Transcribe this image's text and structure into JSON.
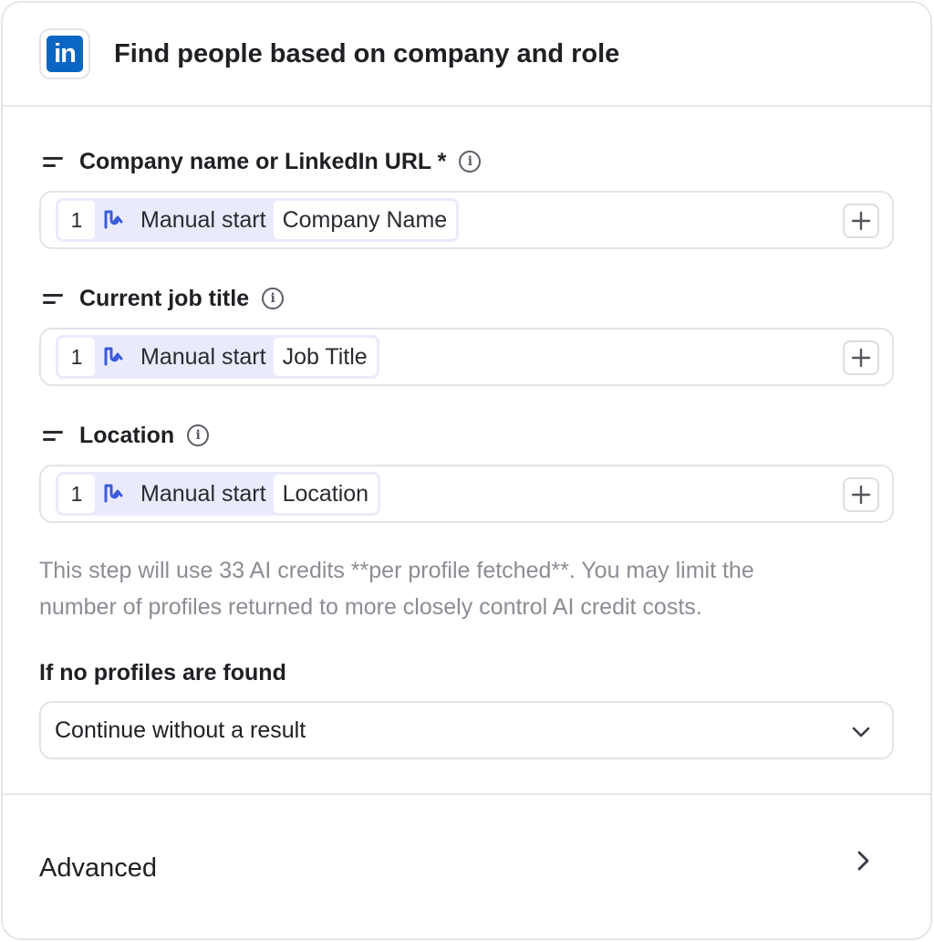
{
  "header": {
    "app_icon_text": "in",
    "title": "Find people based on company and role"
  },
  "fields": [
    {
      "label": "Company name or LinkedIn URL *",
      "token": {
        "step": "1",
        "source": "Manual start",
        "field": "Company Name"
      }
    },
    {
      "label": "Current job title",
      "token": {
        "step": "1",
        "source": "Manual start",
        "field": "Job Title"
      }
    },
    {
      "label": "Location",
      "token": {
        "step": "1",
        "source": "Manual start",
        "field": "Location"
      }
    }
  ],
  "help_text": {
    "line1": "This step will use 33 AI credits **per profile fetched**. You may limit the",
    "line2": "number of profiles returned to more closely control AI credit costs."
  },
  "no_profiles": {
    "label": "If no profiles are found",
    "selected": "Continue without a result"
  },
  "advanced": {
    "label": "Advanced"
  },
  "colors": {
    "linkedin_blue": "#0a66c2",
    "token_bg": "#e9ebfc",
    "token_icon": "#3b5bdb",
    "help_text": "#8c8c94"
  },
  "icons": {
    "app": "linkedin-icon",
    "field": "drag-handle-icon",
    "info": "info-icon",
    "token_source": "flow-trigger-icon",
    "add": "plus-icon",
    "select": "chevron-down-icon",
    "advanced": "chevron-right-icon"
  }
}
